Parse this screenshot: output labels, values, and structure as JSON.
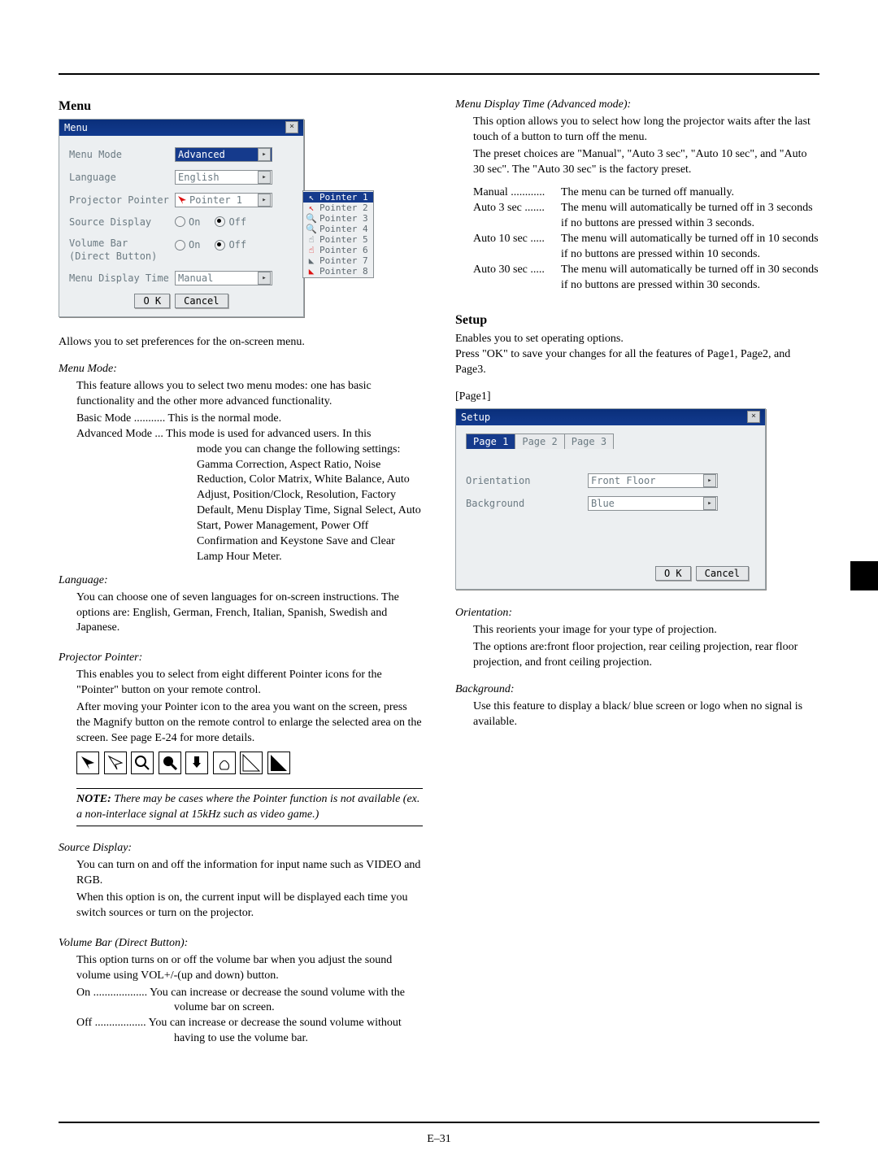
{
  "left": {
    "heading_menu": "Menu",
    "menu_panel": {
      "title": "Menu",
      "rows": {
        "menu_mode": {
          "label": "Menu Mode",
          "value": "Advanced"
        },
        "language": {
          "label": "Language",
          "value": "English"
        },
        "pointer": {
          "label": "Projector Pointer",
          "value": "Pointer 1"
        },
        "source": {
          "label": "Source Display",
          "on": "On",
          "off": "Off",
          "checked": "off"
        },
        "volbar": {
          "label": "Volume Bar\n(Direct Button)",
          "on": "On",
          "off": "Off",
          "checked": "off"
        },
        "disptime": {
          "label": "Menu Display Time",
          "value": "Manual"
        }
      },
      "buttons": {
        "ok": "O K",
        "cancel": "Cancel"
      },
      "pointer_popup": [
        "Pointer 1",
        "Pointer 2",
        "Pointer 3",
        "Pointer 4",
        "Pointer 5",
        "Pointer 6",
        "Pointer 7",
        "Pointer 8"
      ]
    },
    "intro_menu": "Allows you to set preferences for the on-screen menu.",
    "menu_mode": {
      "h": "Menu Mode:",
      "p1": "This feature allows you to select two menu modes: one has basic functionality and the other more advanced functionality.",
      "basic_line": "Basic Mode ........... This is the normal mode.",
      "adv_line_a": "Advanced Mode ... This mode is used for advanced users. In this",
      "adv_line_b": "mode you can change the following settings: Gamma Correction, Aspect Ratio, Noise Reduction, Color Matrix, White Balance, Auto Adjust, Position/Clock, Resolution, Factory Default, Menu Display Time, Signal Select, Auto Start, Power Management, Power Off Confirmation and Keystone Save and Clear Lamp Hour Meter."
    },
    "language": {
      "h": "Language:",
      "p": "You can choose one of seven languages for on-screen instructions. The options are: English, German, French, Italian, Spanish, Swedish and Japanese."
    },
    "pointer": {
      "h": "Projector Pointer:",
      "p1": "This enables you to select from eight different Pointer icons for the \"Pointer\" button on your remote control.",
      "p2": "After moving your Pointer icon to the area you want on the screen, press the Magnify button on the remote control to enlarge the selected area on the screen. See page E-24 for more details.",
      "note_b": "NOTE:",
      "note": " There may be cases where the Pointer function is not available (ex. a non-interlace signal at 15kHz such as video game.)"
    },
    "source": {
      "h": "Source Display:",
      "p1": "You can turn on and off the information for input name such as VIDEO and RGB.",
      "p2": "When this option is on, the current input will be displayed each time you switch sources or turn on the projector."
    },
    "volbar": {
      "h": "Volume Bar (Direct Button):",
      "p1": "This option turns on or off the volume bar when you adjust the sound volume using VOL+/-(up and down) button.",
      "on": "On ................... You can increase or decrease the sound volume with the volume bar on screen.",
      "off": "Off .................. You can increase or decrease the sound volume without having to use the volume bar."
    }
  },
  "right": {
    "mdt": {
      "h": "Menu Display Time (Advanced mode):",
      "p1": "This option allows you to select how long the projector waits after the last touch of a button to turn off the menu.",
      "p2": "The preset choices are \"Manual\", \"Auto 3 sec\", \"Auto 10 sec\", and \"Auto 30 sec\". The \"Auto 30 sec\" is the factory preset.",
      "defs": {
        "manual": {
          "t": "Manual ............",
          "d": "The menu can be turned off manually."
        },
        "a3": {
          "t": "Auto 3 sec .......",
          "d": "The menu will automatically be turned off in 3 seconds if no buttons are pressed within 3 seconds."
        },
        "a10": {
          "t": "Auto 10 sec .....",
          "d": "The menu will automatically be turned off in 10 seconds if no buttons are pressed within 10 seconds."
        },
        "a30": {
          "t": "Auto 30 sec .....",
          "d": "The menu will automatically be turned off in 30 seconds if no buttons are pressed within 30 seconds."
        }
      }
    },
    "setup": {
      "h": "Setup",
      "p1": "Enables you to set operating options.",
      "p2": "Press \"OK\" to save your changes for all the features of Page1, Page2, and Page3.",
      "page1_label": "[Page1]",
      "panel": {
        "title": "Setup",
        "tabs": [
          "Page 1",
          "Page 2",
          "Page 3"
        ],
        "rows": {
          "orientation": {
            "label": "Orientation",
            "value": "Front Floor"
          },
          "background": {
            "label": "Background",
            "value": "Blue"
          }
        },
        "buttons": {
          "ok": "O K",
          "cancel": "Cancel"
        }
      },
      "orientation": {
        "h": "Orientation:",
        "p1": "This reorients your image for your type of projection.",
        "p2": "The options are:front floor projection, rear ceiling projection, rear floor projection, and front ceiling projection."
      },
      "background": {
        "h": "Background:",
        "p": "Use this feature to display a black/ blue screen or logo when no signal is available."
      }
    }
  },
  "page_number": "E–31"
}
